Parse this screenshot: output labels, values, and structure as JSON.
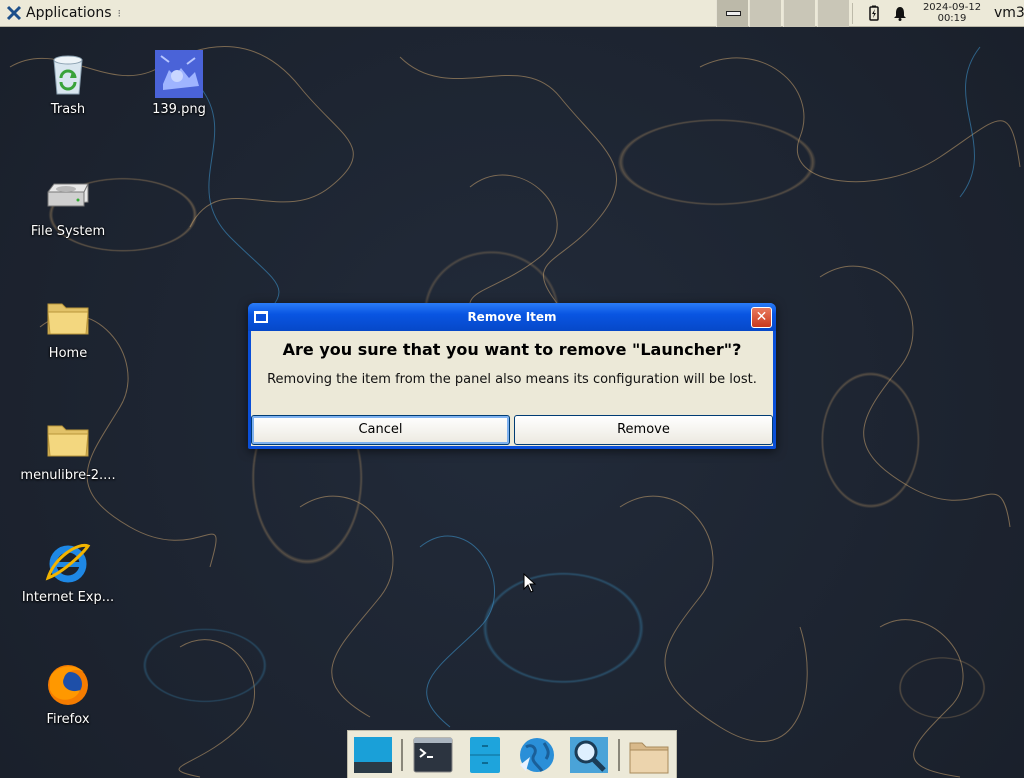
{
  "top_panel": {
    "apps_label": "Applications",
    "date": "2024-09-12",
    "time": "00:19",
    "hostname": "vm3"
  },
  "desktop_icons": [
    {
      "label": "Trash",
      "icon": "trash-icon"
    },
    {
      "label": "139.png",
      "icon": "image-file-icon"
    },
    {
      "label": "File System",
      "icon": "drive-icon"
    },
    {
      "label": "Home",
      "icon": "folder-icon"
    },
    {
      "label": "menulibre-2....",
      "icon": "folder-icon"
    },
    {
      "label": "Internet Exp...",
      "icon": "internet-explorer-icon"
    },
    {
      "label": "Firefox",
      "icon": "firefox-icon"
    }
  ],
  "dialog": {
    "title": "Remove Item",
    "heading": "Are you sure that you want to remove \"Launcher\"?",
    "message": "Removing the item from the panel also means its configuration will be lost.",
    "cancel_label": "Cancel",
    "remove_label": "Remove"
  },
  "dock": {
    "items": [
      "show-desktop-icon",
      "terminal-icon",
      "file-manager-icon",
      "web-browser-icon",
      "app-finder-icon",
      "folder-icon"
    ]
  }
}
